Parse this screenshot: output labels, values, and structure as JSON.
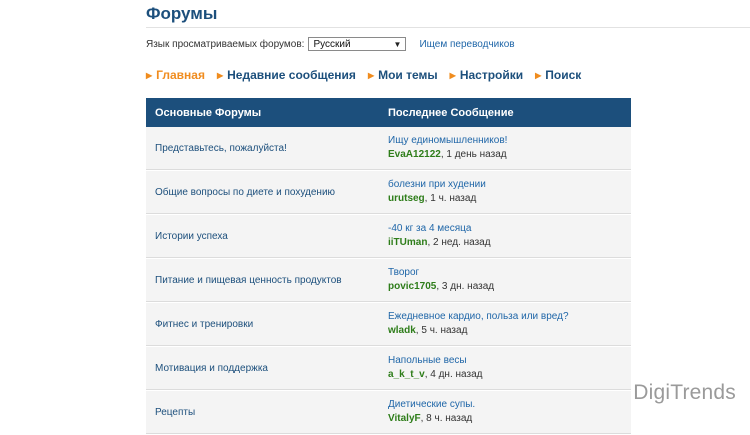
{
  "page": {
    "title": "Форумы"
  },
  "language": {
    "label": "Язык просматриваемых форумов:",
    "selected": "Русский",
    "translators_link": "Ищем переводчиков"
  },
  "nav": [
    {
      "label": "Главная",
      "active": true
    },
    {
      "label": "Недавние сообщения",
      "active": false
    },
    {
      "label": "Мои темы",
      "active": false
    },
    {
      "label": "Настройки",
      "active": false
    },
    {
      "label": "Поиск",
      "active": false
    }
  ],
  "table": {
    "headers": {
      "forums": "Основные Форумы",
      "last_post": "Последнее Сообщение"
    },
    "rows": [
      {
        "forum": "Представьтесь, пожалуйста!",
        "post": "Ищу единомышленников!",
        "user": "EvaA12122",
        "time": ", 1 день назад"
      },
      {
        "forum": "Общие вопросы по диете и похудению",
        "post": "болезни при худении",
        "user": "urutseg",
        "time": ", 1 ч. назад"
      },
      {
        "forum": "Истории успеха",
        "post": "-40 кг за 4 месяца",
        "user": "iiTUman",
        "time": ", 2 нед. назад"
      },
      {
        "forum": "Питание и пищевая ценность продуктов",
        "post": "Творог",
        "user": "povic1705",
        "time": ", 3 дн. назад"
      },
      {
        "forum": "Фитнес и тренировки",
        "post": "Ежедневное кардио, польза или вред?",
        "user": "wladk",
        "time": ", 5 ч. назад"
      },
      {
        "forum": "Мотивация и поддержка",
        "post": "Напольные весы",
        "user": "a_k_t_v",
        "time": ", 4 дн. назад"
      },
      {
        "forum": "Рецепты",
        "post": "Диетические супы.",
        "user": "VitalyF",
        "time": ", 8 ч. назад"
      }
    ]
  },
  "watermark": "DigiTrends"
}
